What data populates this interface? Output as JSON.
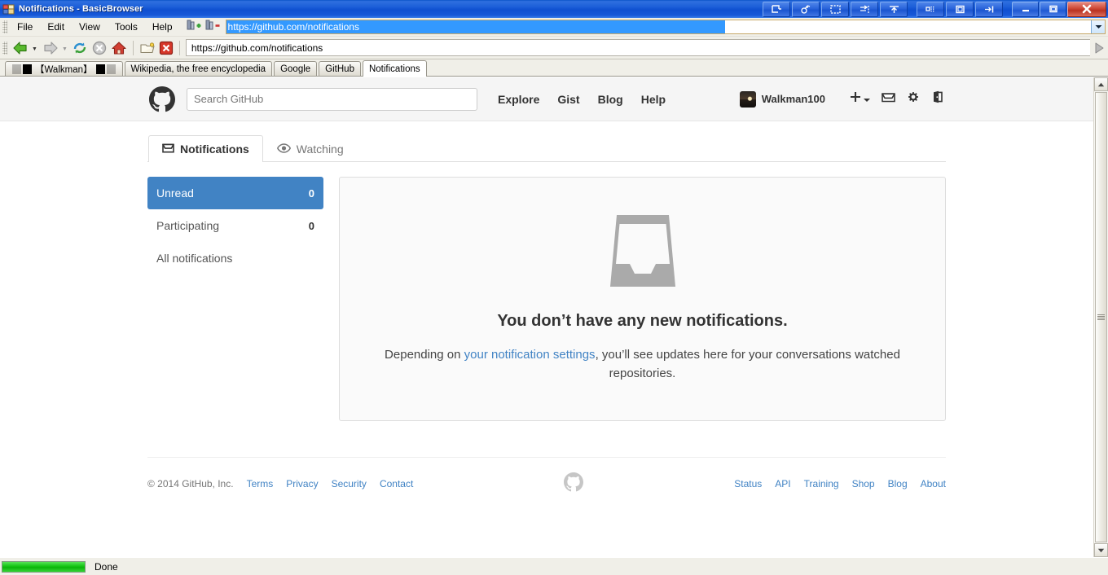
{
  "window": {
    "title": "Notifications - BasicBrowser",
    "app_icon": "app-icon",
    "wm_buttons": [
      {
        "name": "rollup-button",
        "glyph": "rollup-icon"
      },
      {
        "name": "shade-button",
        "glyph": "shade-icon"
      },
      {
        "name": "fullscreen-button",
        "glyph": "fullscreen-icon"
      },
      {
        "name": "send-to-back-button",
        "glyph": "send-to-back-icon"
      },
      {
        "name": "always-on-top-button",
        "glyph": "always-on-top-icon"
      },
      {
        "name": "desktop-button",
        "glyph": "desktop-icon"
      },
      {
        "name": "restore-size-button",
        "glyph": "restore-size-icon"
      },
      {
        "name": "pin-button",
        "glyph": "pin-icon"
      }
    ],
    "minimize_label": "–",
    "maximize_label": "❐",
    "close_label": "✕"
  },
  "menubar": {
    "items": [
      {
        "label": "File"
      },
      {
        "label": "Edit"
      },
      {
        "label": "View"
      },
      {
        "label": "Tools"
      },
      {
        "label": "Help"
      }
    ],
    "icons": [
      {
        "name": "add-bookmark-icon"
      },
      {
        "name": "remove-bookmark-icon"
      }
    ],
    "url_value": "https://github.com/notifications",
    "url_dropdown": "chevron-down-icon"
  },
  "toolbar": {
    "buttons": [
      {
        "name": "back-button",
        "glyph": "back-arrow-icon"
      },
      {
        "name": "back-history-button",
        "glyph": "chevron-down-icon"
      },
      {
        "name": "forward-button",
        "glyph": "forward-arrow-icon"
      },
      {
        "name": "forward-history-button",
        "glyph": "chevron-down-icon"
      },
      {
        "name": "reload-button",
        "glyph": "reload-icon"
      },
      {
        "name": "stop-button",
        "glyph": "stop-icon"
      },
      {
        "name": "home-button",
        "glyph": "home-icon"
      },
      {
        "name": "open-file-button",
        "glyph": "folder-icon"
      },
      {
        "name": "close-page-button",
        "glyph": "close-red-icon"
      }
    ],
    "address_value": "https://github.com/notifications",
    "go_button": "play-arrow-icon"
  },
  "browser_tabs": [
    {
      "label": "【Walkman】",
      "label_prefix": "░▒█",
      "label_suffix": "█▒░",
      "active": false
    },
    {
      "label": "Wikipedia, the free encyclopedia",
      "active": false
    },
    {
      "label": "Google",
      "active": false
    },
    {
      "label": "GitHub",
      "active": false
    },
    {
      "label": "Notifications",
      "active": true
    }
  ],
  "github": {
    "logo": "github-mark-icon",
    "search": {
      "placeholder": "Search GitHub",
      "value": ""
    },
    "nav": [
      {
        "label": "Explore"
      },
      {
        "label": "Gist"
      },
      {
        "label": "Blog"
      },
      {
        "label": "Help"
      }
    ],
    "account": {
      "avatar": "user-avatar",
      "username": "Walkman100",
      "icons": [
        {
          "name": "create-new-icon",
          "glyph": "plus-icon"
        },
        {
          "name": "notifications-inbox-icon",
          "glyph": "inbox-icon"
        },
        {
          "name": "settings-gear-icon",
          "glyph": "gear-icon"
        },
        {
          "name": "sign-out-icon",
          "glyph": "sign-out-icon"
        }
      ]
    },
    "tabs": [
      {
        "label": "Notifications",
        "icon": "inbox-icon",
        "active": true
      },
      {
        "label": "Watching",
        "icon": "eye-icon",
        "active": false
      }
    ],
    "sidebar": [
      {
        "label": "Unread",
        "count": "0",
        "active": true
      },
      {
        "label": "Participating",
        "count": "0",
        "active": false
      },
      {
        "label": "All notifications",
        "count": "",
        "active": false
      }
    ],
    "blankslate": {
      "icon": "inbox-tray-icon",
      "title": "You don’t have any new notifications.",
      "text_before": "Depending on ",
      "link": "your notification settings",
      "text_after": ", you’ll see updates here for your conversations watched repositories."
    },
    "footer": {
      "copyright": "© 2014 GitHub, Inc.",
      "left_links": [
        {
          "label": "Terms"
        },
        {
          "label": "Privacy"
        },
        {
          "label": "Security"
        },
        {
          "label": "Contact"
        }
      ],
      "mark": "github-mark-icon",
      "right_links": [
        {
          "label": "Status"
        },
        {
          "label": "API"
        },
        {
          "label": "Training"
        },
        {
          "label": "Shop"
        },
        {
          "label": "Blog"
        },
        {
          "label": "About"
        }
      ]
    }
  },
  "statusbar": {
    "progress_percent": 100,
    "text": "Done"
  },
  "colors": {
    "accent_blue": "#4183c4",
    "titlebar_blue": "#1c5fd8",
    "progress_green": "#13c413",
    "selection_blue": "#3399ff"
  }
}
